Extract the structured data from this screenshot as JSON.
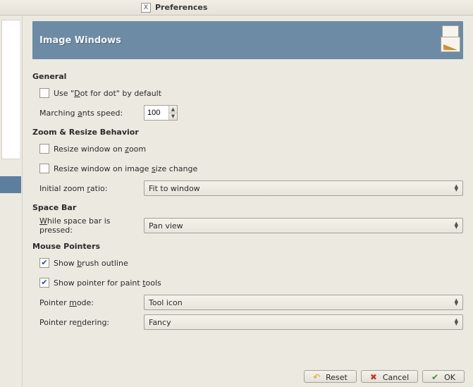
{
  "window": {
    "title": "Preferences",
    "app_icon_letter": "X"
  },
  "banner": {
    "title": "Image Windows"
  },
  "sections": {
    "general": {
      "head": "General",
      "dot_for_dot": {
        "pre": "Use \"",
        "u": "D",
        "post": "ot for dot\" by default",
        "checked": false
      },
      "marching": {
        "pre": "Marching ",
        "u": "a",
        "post": "nts speed:",
        "value": "100"
      }
    },
    "zoom": {
      "head": "Zoom & Resize Behavior",
      "resize_zoom": {
        "pre": "Resize window on ",
        "u": "z",
        "post": "oom",
        "checked": false
      },
      "resize_size": {
        "pre": "Resize window on image ",
        "u": "s",
        "post": "ize change",
        "checked": false
      },
      "ratio": {
        "pre": "Initial zoom ",
        "u": "r",
        "post": "atio:",
        "value": "Fit to window"
      }
    },
    "spacebar": {
      "head": "Space Bar",
      "pressed": {
        "u": "W",
        "post": "hile space bar is pressed:",
        "value": "Pan view"
      }
    },
    "mouse": {
      "head": "Mouse Pointers",
      "brush": {
        "pre": "Show ",
        "u": "b",
        "post": "rush outline",
        "checked": true
      },
      "paint": {
        "pre": "Show pointer for paint ",
        "u": "t",
        "post": "ools",
        "checked": true
      },
      "mode": {
        "pre": "Pointer ",
        "u": "m",
        "post": "ode:",
        "value": "Tool icon"
      },
      "rendering": {
        "pre": "Pointer re",
        "u": "n",
        "post": "dering:",
        "value": "Fancy"
      }
    }
  },
  "buttons": {
    "reset": "Reset",
    "cancel": "Cancel",
    "ok": "OK"
  }
}
